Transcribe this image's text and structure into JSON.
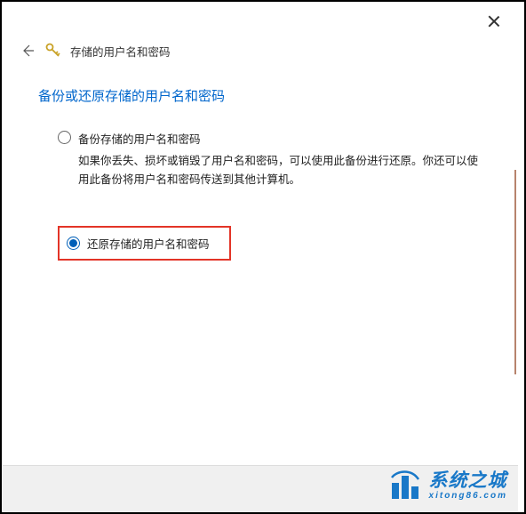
{
  "header": {
    "title": "存储的用户名和密码"
  },
  "main": {
    "heading": "备份或还原存储的用户名和密码",
    "options": {
      "backup": {
        "label": "备份存储的用户名和密码",
        "description": "如果你丢失、损坏或销毁了用户名和密码，可以使用此备份进行还原。你还可以使用此备份将用户名和密码传送到其他计算机。",
        "selected": false
      },
      "restore": {
        "label": "还原存储的用户名和密码",
        "selected": true
      }
    }
  },
  "watermark": {
    "brand": "系统之城",
    "domain": "xitong86.com"
  }
}
